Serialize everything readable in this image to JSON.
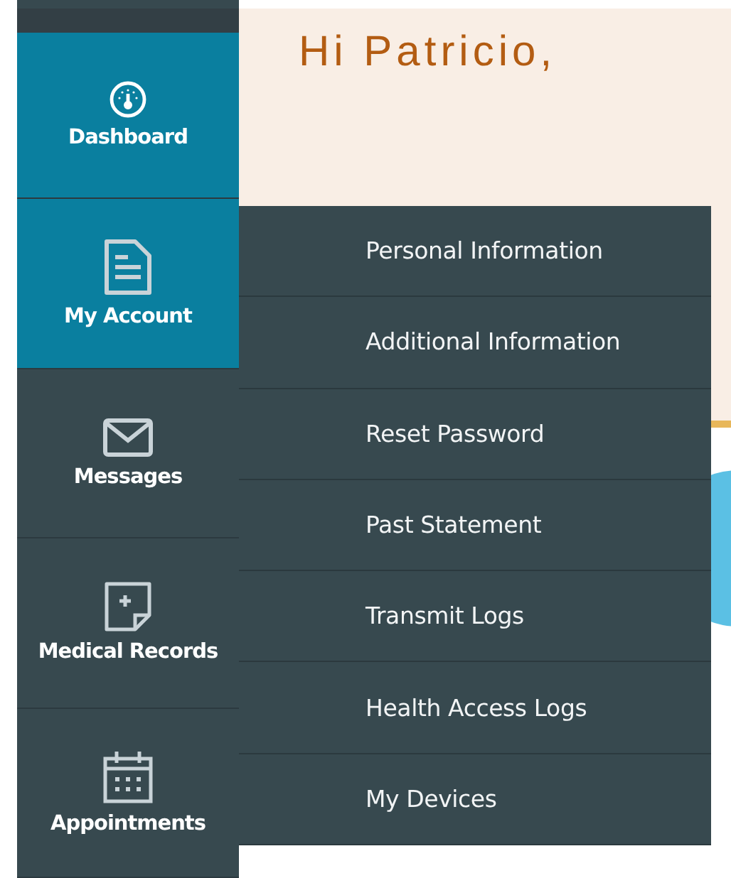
{
  "greeting": "Hi Patricio,",
  "sidebar": {
    "items": [
      {
        "label": "Dashboard",
        "selected": true,
        "expanded": false
      },
      {
        "label": "My Account",
        "selected": true,
        "expanded": true
      },
      {
        "label": "Messages",
        "selected": false,
        "expanded": false
      },
      {
        "label": "Medical Records",
        "selected": false,
        "expanded": false
      },
      {
        "label": "Appointments",
        "selected": false,
        "expanded": false
      }
    ]
  },
  "submenu": {
    "items": [
      "Personal Information",
      "Additional Information",
      "Reset Password",
      "Past Statement",
      "Transmit Logs",
      "Health Access Logs",
      "My Devices"
    ]
  }
}
